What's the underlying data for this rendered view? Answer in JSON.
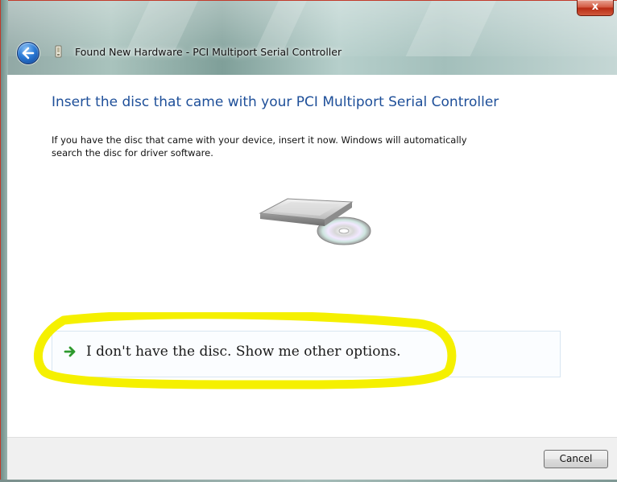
{
  "window": {
    "title": "Found New Hardware - PCI Multiport Serial Controller",
    "close_label": "x"
  },
  "content": {
    "heading": "Insert the disc that came with your PCI Multiport Serial Controller",
    "body_line1": "If you have the disc that came with your device, insert it now.  Windows will automatically",
    "body_line2": "search the disc for driver software.",
    "command_link": "I don't have the disc.  Show me other options."
  },
  "footer": {
    "cancel_label": "Cancel"
  },
  "icons": {
    "back": "back-arrow-icon",
    "device": "device-icon",
    "disc_drive": "disc-drive-icon",
    "command_arrow": "green-arrow-icon"
  },
  "colors": {
    "heading": "#1e4f99",
    "highlight": "#f5f000",
    "arrow": "#2e9a2e"
  }
}
